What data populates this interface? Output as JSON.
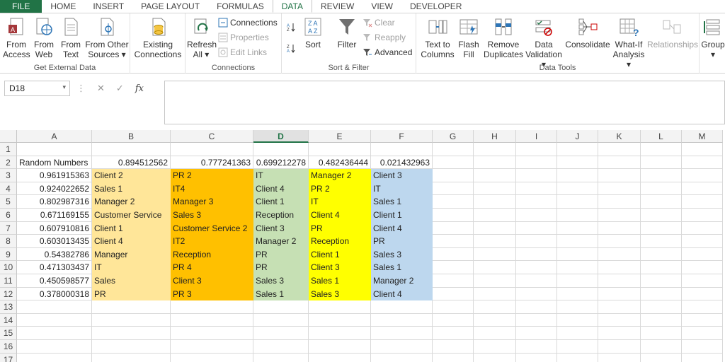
{
  "tabs": [
    {
      "label": "FILE"
    },
    {
      "label": "HOME"
    },
    {
      "label": "INSERT"
    },
    {
      "label": "PAGE LAYOUT"
    },
    {
      "label": "FORMULAS"
    },
    {
      "label": "DATA"
    },
    {
      "label": "REVIEW"
    },
    {
      "label": "VIEW"
    },
    {
      "label": "DEVELOPER"
    }
  ],
  "ribbon": {
    "get_external": {
      "label": "Get External Data",
      "from_access": {
        "line1": "From",
        "line2": "Access"
      },
      "from_web": {
        "line1": "From",
        "line2": "Web"
      },
      "from_text": {
        "line1": "From",
        "line2": "Text"
      },
      "from_other": {
        "line1": "From Other",
        "line2": "Sources ▾"
      }
    },
    "existing": {
      "line1": "Existing",
      "line2": "Connections"
    },
    "connections": {
      "label": "Connections",
      "refresh": {
        "line1": "Refresh",
        "line2": "All ▾"
      },
      "connections": "Connections",
      "properties": "Properties",
      "edit_links": "Edit Links"
    },
    "sort_filter": {
      "label": "Sort & Filter",
      "sort": "Sort",
      "filter": "Filter",
      "clear": "Clear",
      "reapply": "Reapply",
      "advanced": "Advanced"
    },
    "data_tools": {
      "label": "Data Tools",
      "text_to_columns": {
        "line1": "Text to",
        "line2": "Columns"
      },
      "flash_fill": {
        "line1": "Flash",
        "line2": "Fill"
      },
      "remove_duplicates": {
        "line1": "Remove",
        "line2": "Duplicates"
      },
      "data_validation": {
        "line1": "Data",
        "line2": "Validation ▾"
      },
      "consolidate": "Consolidate",
      "what_if": {
        "line1": "What-If",
        "line2": "Analysis ▾"
      },
      "relationships": "Relationships"
    },
    "outline": {
      "group": "Group",
      "group_dd": "▾"
    }
  },
  "formula_bar": {
    "name_box": "D18",
    "name_dd": "▾",
    "cancel": "✕",
    "enter": "✓",
    "fx": "fx",
    "dots": "⋮",
    "value": ""
  },
  "columns": [
    "A",
    "B",
    "C",
    "D",
    "E",
    "F",
    "G",
    "H",
    "I",
    "J",
    "K",
    "L",
    "M"
  ],
  "rows": [
    "1",
    "2",
    "3",
    "4",
    "5",
    "6",
    "7",
    "8",
    "9",
    "10",
    "11",
    "12",
    "13",
    "14",
    "15",
    "16",
    "17"
  ],
  "sheet": {
    "r2": {
      "a": "Random Numbers",
      "b": "0.894512562",
      "c": "0.777241363",
      "d": "0.699212278",
      "e": "0.482436444",
      "f": "0.021432963"
    },
    "body": [
      {
        "a": "0.961915363",
        "b": "Client 2",
        "c": "PR 2",
        "d": "IT",
        "e": "Manager 2",
        "f": "Client 3"
      },
      {
        "a": "0.924022652",
        "b": "Sales 1",
        "c": "IT4",
        "d": "Client 4",
        "e": "PR 2",
        "f": "IT"
      },
      {
        "a": "0.802987316",
        "b": "Manager 2",
        "c": "Manager 3",
        "d": "Client 1",
        "e": "IT",
        "f": "Sales 1"
      },
      {
        "a": "0.671169155",
        "b": "Customer Service",
        "c": "Sales 3",
        "d": "Reception",
        "e": "Client 4",
        "f": "Client 1"
      },
      {
        "a": "0.607910816",
        "b": "Client 1",
        "c": "Customer Service 2",
        "d": "Client 3",
        "e": "PR",
        "f": "Client 4"
      },
      {
        "a": "0.603013435",
        "b": "Client 4",
        "c": "IT2",
        "d": "Manager 2",
        "e": "Reception",
        "f": "PR"
      },
      {
        "a": "0.54382786",
        "b": "Manager",
        "c": "Reception",
        "d": "PR",
        "e": "Client 1",
        "f": "Sales 3"
      },
      {
        "a": "0.471303437",
        "b": "IT",
        "c": "PR 4",
        "d": "PR",
        "e": "Client 3",
        "f": "Sales 1"
      },
      {
        "a": "0.450598577",
        "b": "Sales",
        "c": "Client 3",
        "d": "Sales 3",
        "e": "Sales 1",
        "f": "Manager 2"
      },
      {
        "a": "0.378000318",
        "b": "PR",
        "c": "PR 3",
        "d": "Sales 1",
        "e": "Sales 3",
        "f": "Client 4"
      }
    ]
  },
  "colors": {
    "accent": "#217346",
    "col_b": "#ffe699",
    "col_c": "#ffc000",
    "col_d": "#c6e0b4",
    "col_e": "#ffff00",
    "col_f": "#bdd7ee"
  }
}
